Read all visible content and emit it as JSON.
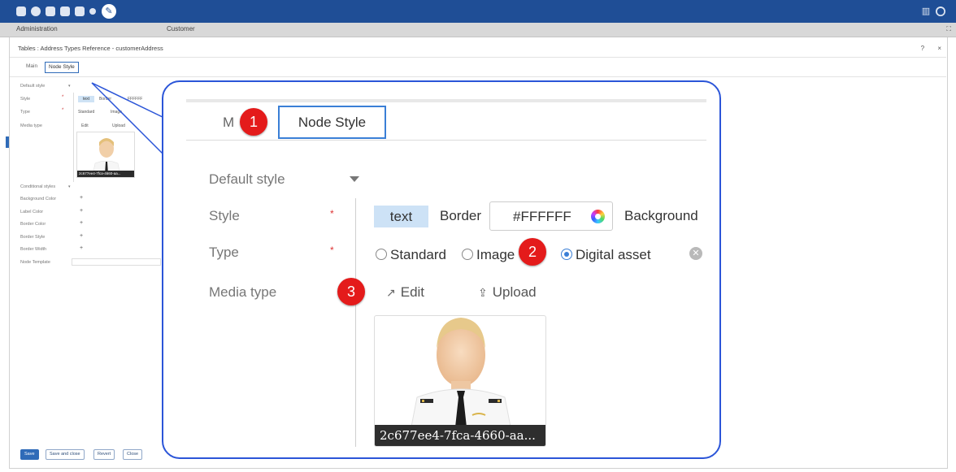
{
  "topbar": {
    "icons": [
      "database-icon",
      "history-icon",
      "document-icon",
      "document-stack-icon",
      "document-edit-icon",
      "pin-icon",
      "wrench-icon"
    ],
    "right_icons": [
      "panel-icon",
      "user-circle-icon"
    ]
  },
  "tabstrip": {
    "tabs": [
      {
        "label": "Administration"
      },
      {
        "label": "Customer"
      }
    ]
  },
  "breadcrumb": {
    "text": "Tables   :  Address Types Reference - customerAddress",
    "help": "?",
    "close": "×"
  },
  "subtabs": [
    {
      "label": "Main"
    },
    {
      "label": "Node Style"
    }
  ],
  "small_form": {
    "default_style": "Default style",
    "style": "Style",
    "type": "Type",
    "media_type": "Media type",
    "text_chip": "text",
    "border_partial": "Border",
    "color_partial": "FFFFFF",
    "radio_standard": "Standard",
    "radio_image": "Image",
    "edit": "Edit",
    "upload": "Upload",
    "thumb_caption": "2c677ee4-7fca-4660-aa...",
    "conditional_styles": "Conditional styles",
    "background_color": "Background Color",
    "label_color": "Label Color",
    "border_color": "Border Color",
    "border_style": "Border Style",
    "border_width": "Border Width",
    "node_template": "Node Template"
  },
  "buttons": {
    "save": "Save",
    "save_and_close": "Save and close",
    "revert": "Revert",
    "close": "Close"
  },
  "zoom": {
    "tab_main_partial": "M",
    "tab_node_style": "Node Style",
    "default_style": "Default style",
    "style": "Style",
    "type": "Type",
    "media_type": "Media type",
    "required_mark": "*",
    "text_chip": "text",
    "border_label": "Border",
    "color_value": "#FFFFFF",
    "background_label": "Background",
    "radio_standard": "Standard",
    "radio_image": "Image",
    "radio_digital_asset": "Digital asset",
    "selected_type": "Digital asset",
    "edit": "Edit",
    "upload": "Upload",
    "thumb_caption": "2c677ee4-7fca-4660-aa..."
  },
  "badges": [
    "1",
    "2",
    "3"
  ],
  "colors": {
    "topbar": "#1f4e96",
    "callout_border": "#2b55d8",
    "badge": "#e41b1b",
    "active_tab_border": "#3a7fd6"
  }
}
